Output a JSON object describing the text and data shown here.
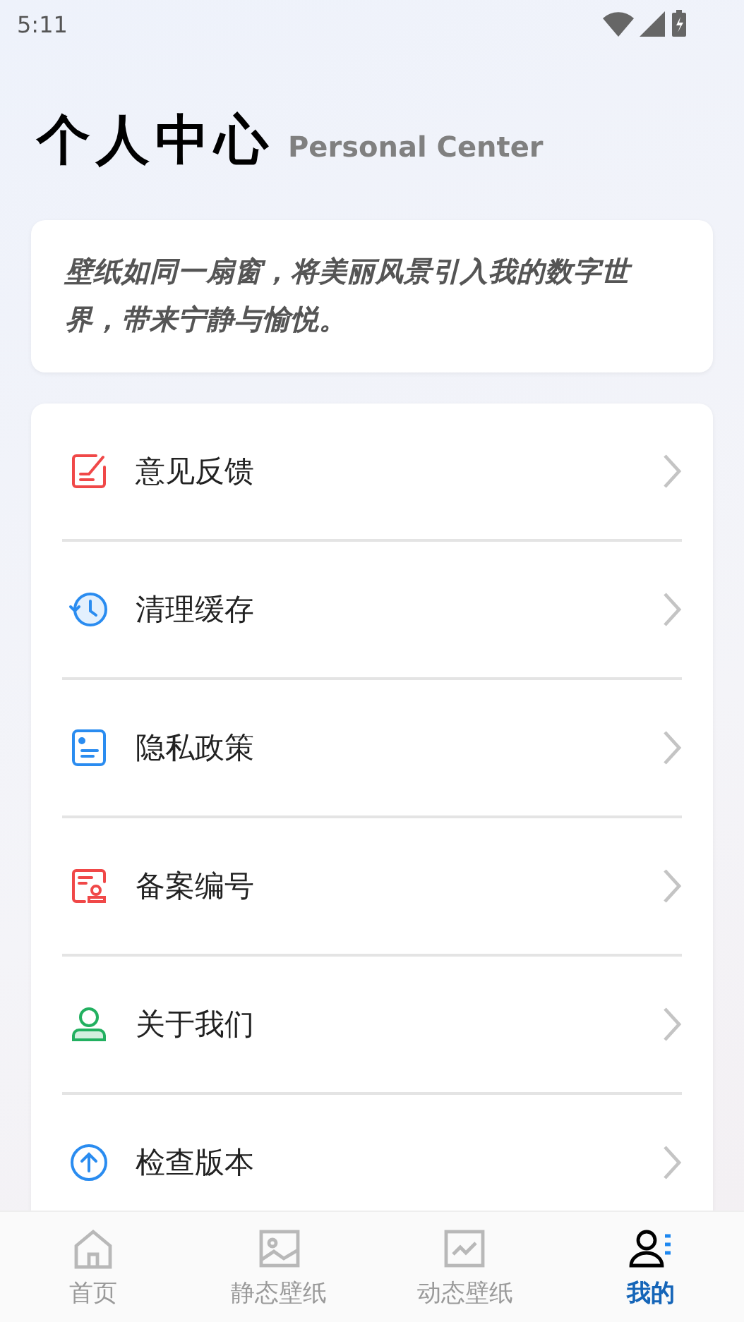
{
  "status_bar": {
    "time": "5:11"
  },
  "header": {
    "title": "个人中心",
    "subtitle": "Personal Center"
  },
  "quote": "壁纸如同一扇窗，将美丽风景引入我的数字世界，带来宁静与愉悦。",
  "menu": [
    {
      "label": "意见反馈",
      "kind": "feedback",
      "color": "#f04848"
    },
    {
      "label": "清理缓存",
      "kind": "history",
      "color": "#2a8cf0"
    },
    {
      "label": "隐私政策",
      "kind": "document",
      "color": "#2a8cf0"
    },
    {
      "label": "备案编号",
      "kind": "stamp",
      "color": "#f04848"
    },
    {
      "label": "关于我们",
      "kind": "person",
      "color": "#22b060"
    },
    {
      "label": "检查版本",
      "kind": "upload",
      "color": "#2a8cf0"
    }
  ],
  "tabs": [
    {
      "label": "首页",
      "kind": "home",
      "selected": false
    },
    {
      "label": "静态壁纸",
      "kind": "image",
      "selected": false
    },
    {
      "label": "动态壁纸",
      "kind": "chart",
      "selected": false
    },
    {
      "label": "我的",
      "kind": "profile",
      "selected": true
    }
  ]
}
